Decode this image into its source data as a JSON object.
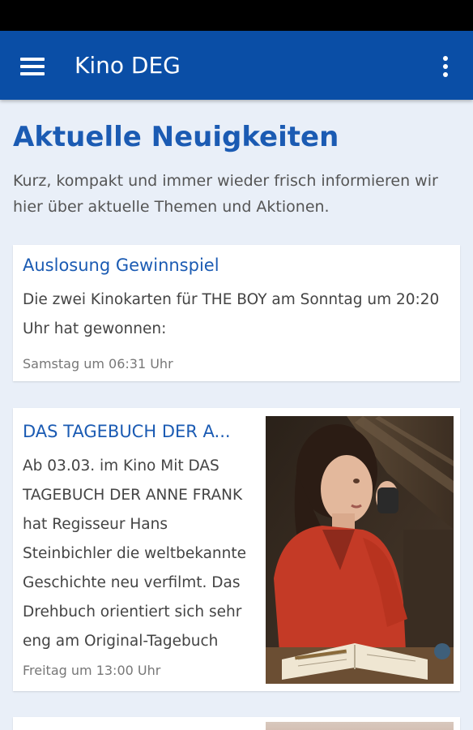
{
  "app": {
    "title": "Kino DEG",
    "menu_icon": "hamburger-menu-icon",
    "overflow_icon": "more-vert-icon",
    "brand_color": "#0a4ea6"
  },
  "page": {
    "heading": "Aktuelle Neuigkeiten",
    "intro": "Kurz, kompakt und immer wieder frisch informieren wir hier über aktuelle Themen und Aktionen."
  },
  "news": [
    {
      "title": "Auslosung Gewinnspiel",
      "text": "Die zwei Kinokarten für THE BOY am Sonntag um 20:20 Uhr hat gewonnen:",
      "date": "Samstag um 06:31 Uhr"
    },
    {
      "title": "DAS TAGEBUCH DER A...",
      "text": "Ab 03.03. im Kino Mit DAS TAGEBUCH DER ANNE FRANK hat Regisseur Hans Steinbichler die weltbekannte Geschichte neu verfilmt. Das Drehbuch orientiert sich sehr eng am Original-Tagebuch",
      "date": "Freitag um 13:00 Uhr"
    }
  ]
}
